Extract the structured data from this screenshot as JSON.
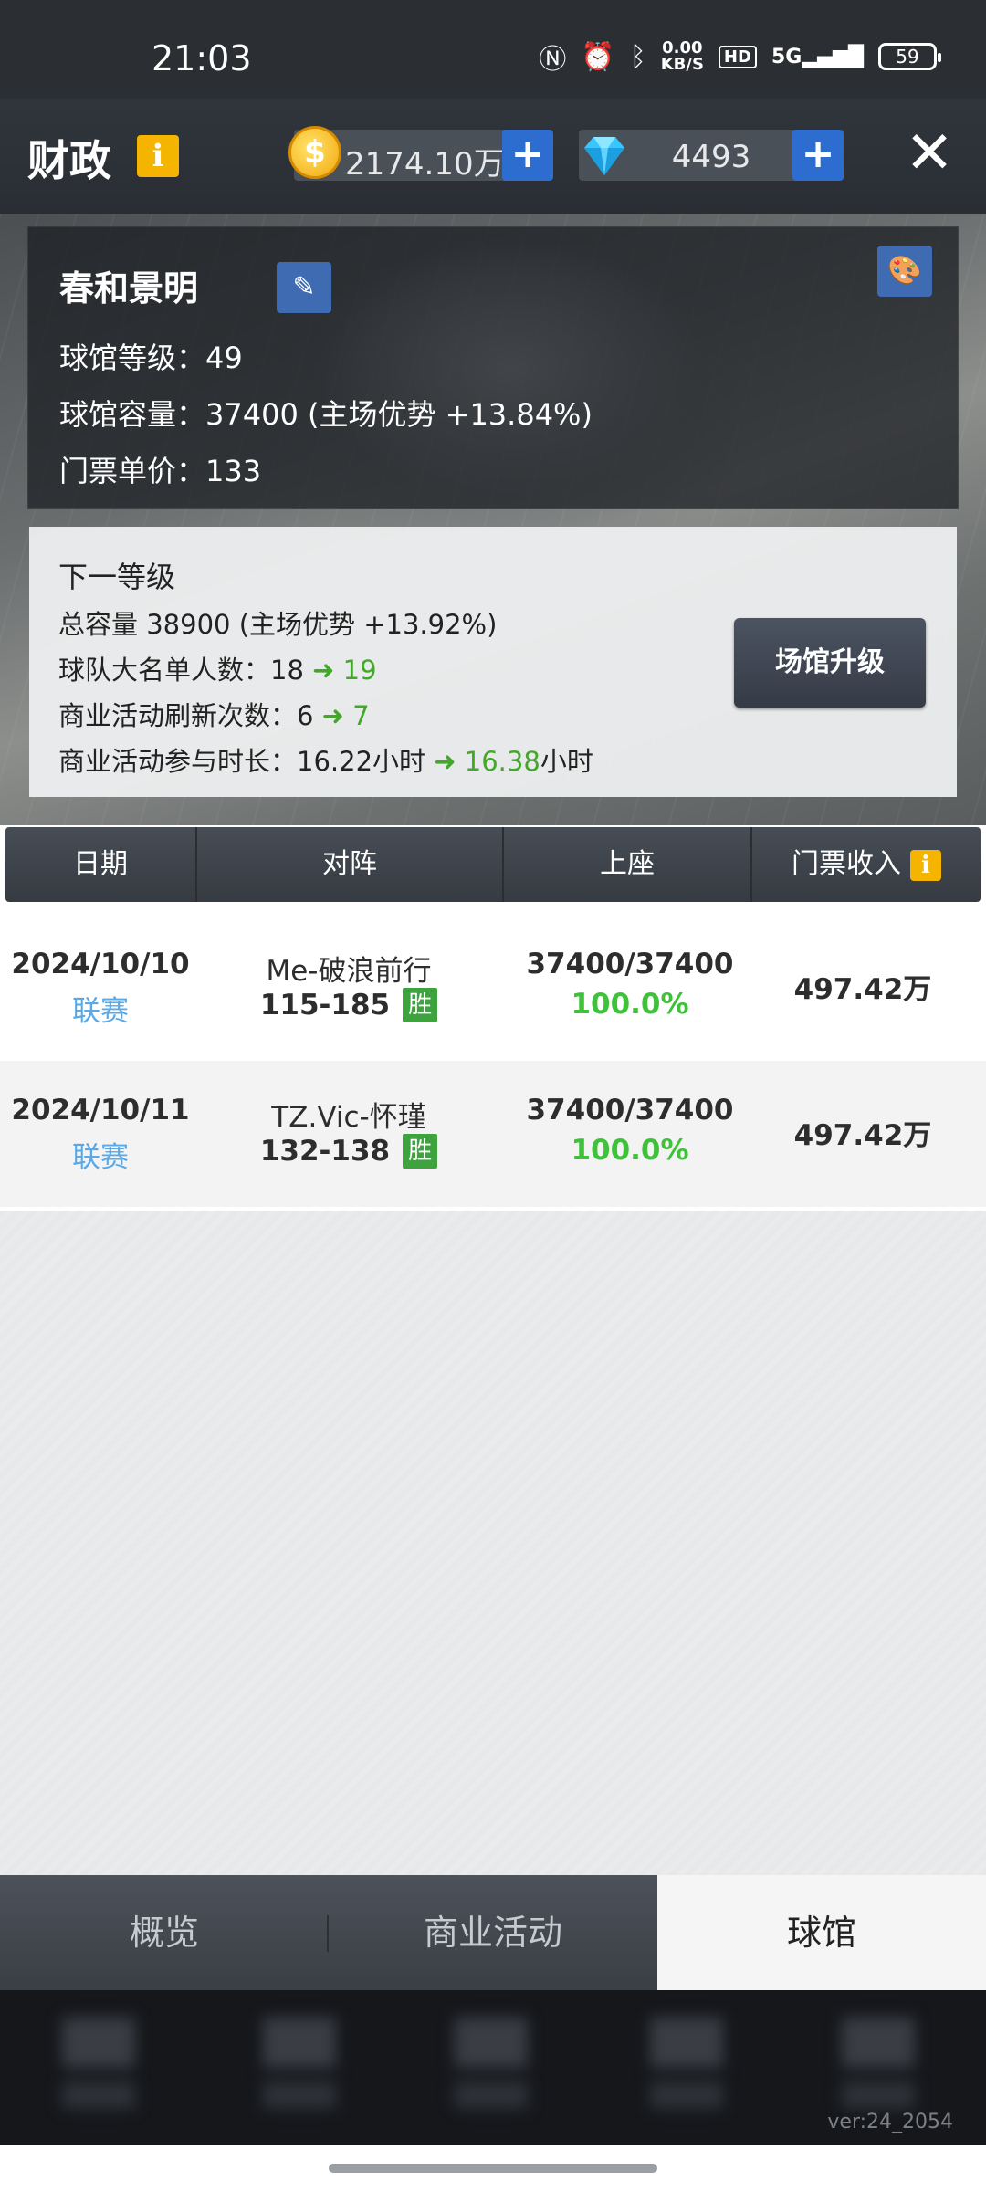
{
  "status_bar": {
    "time": "21:03",
    "net_speed_value": "0.00",
    "net_speed_unit": "KB/S",
    "hd": "HD",
    "signal": "5G",
    "battery": "59"
  },
  "header": {
    "title": "财政",
    "info_icon": "i",
    "coins": "2174.10万",
    "gems": "4493",
    "plus": "+",
    "close": "✕"
  },
  "venue": {
    "name": "春和景明",
    "level": "球馆等级：49",
    "capacity": "球馆容量：37400 (主场优势 +13.84%)",
    "ticket_price": "门票单价：133"
  },
  "next_level": {
    "title": "下一等级",
    "total_capacity": "总容量  38900 (主场优势 +13.92%)",
    "roster_label": "球队大名单人数：18",
    "roster_next": "19",
    "refresh_label": "商业活动刷新次数：6",
    "refresh_next": "7",
    "duration_label": "商业活动参与时长：16.22小时",
    "duration_next": "16.38",
    "duration_unit": "小时",
    "upgrade_button": "场馆升级"
  },
  "table": {
    "headers": [
      "日期",
      "对阵",
      "上座",
      "门票收入"
    ],
    "rows": [
      {
        "date": "2024/10/10",
        "type": "联赛",
        "opponent": "Me-破浪前行",
        "score": "115-185",
        "result": "胜",
        "seats": "37400/37400",
        "pct": "100.0%",
        "income": "497.42万"
      },
      {
        "date": "2024/10/11",
        "type": "联赛",
        "opponent": "TZ.Vic-怀瑾",
        "score": "132-138",
        "result": "胜",
        "seats": "37400/37400",
        "pct": "100.0%",
        "income": "497.42万"
      }
    ]
  },
  "tabs": [
    "概览",
    "商业活动",
    "球馆"
  ],
  "version": "ver:24_2054",
  "colors": {
    "accent_blue": "#2d6dcf",
    "win_green": "#3ea23f",
    "percent_green": "#3fc13a",
    "league_blue": "#5aa9e6",
    "info_yellow": "#f5b400"
  }
}
